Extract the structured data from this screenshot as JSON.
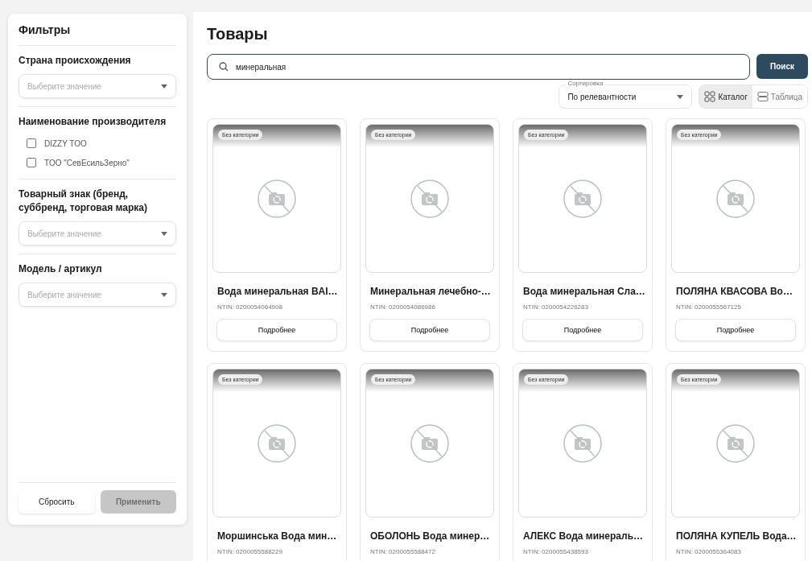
{
  "filters": {
    "title": "Фильтры",
    "sections": [
      {
        "kind": "select",
        "label": "Страна происхождения",
        "placeholder": "Выберите значение"
      },
      {
        "kind": "checklist",
        "label": "Наименование производителя",
        "options": [
          {
            "label": "DIZZY TOO",
            "checked": false
          },
          {
            "label": "TOO \"СевЕсильЗерно\"",
            "checked": false
          }
        ]
      },
      {
        "kind": "select",
        "label": "Товарный знак (бренд, суббренд, торговая марка)",
        "placeholder": "Выберите значение"
      },
      {
        "kind": "select",
        "label": "Модель / артикул",
        "placeholder": "Выберите значение"
      }
    ],
    "reset_button": "Сбросить",
    "apply_button": {
      "label": "Применить",
      "disabled": true
    }
  },
  "page_title": "Товары",
  "search": {
    "value": "минеральная",
    "button": "Поиск"
  },
  "sort": {
    "label": "Сортировка",
    "value": "По релевантности"
  },
  "view_tabs": [
    {
      "label": "Каталог",
      "kind": "grid",
      "selected": true
    },
    {
      "label": "Таблица",
      "kind": "rows",
      "selected": false
    }
  ],
  "products": [
    {
      "category": "Без категории",
      "name": "Вода минеральная BAI…",
      "ntin": "NTIN: 0200054064908",
      "button": "Подробнее"
    },
    {
      "category": "Без категории",
      "name": "Минеральная лечебно-…",
      "ntin": "NTIN: 0200054086986",
      "button": "Подробнее"
    },
    {
      "category": "Без категории",
      "name": "Вода минеральная Сла…",
      "ntin": "NTIN: 0200054226283",
      "button": "Подробнее"
    },
    {
      "category": "Без категории",
      "name": "ПОЛЯНА КВАСОВА Во…",
      "ntin": "NTIN: 0200055567125",
      "button": "Подробнее"
    },
    {
      "category": "Без категории",
      "name": "Моршинська Вода мин…",
      "ntin": "NTIN: 0200055588229"
    },
    {
      "category": "Без категории",
      "name": "ОБОЛОНЬ Вода минер…",
      "ntin": "NTIN: 0200055588472"
    },
    {
      "category": "Без категории",
      "name": "АЛЕКС Вода минераль…",
      "ntin": "NTIN: 0200055438593"
    },
    {
      "category": "Без категории",
      "name": "ПОЛЯНА КУПЕЛЬ Вода…",
      "ntin": "NTIN: 0200055364083"
    }
  ]
}
